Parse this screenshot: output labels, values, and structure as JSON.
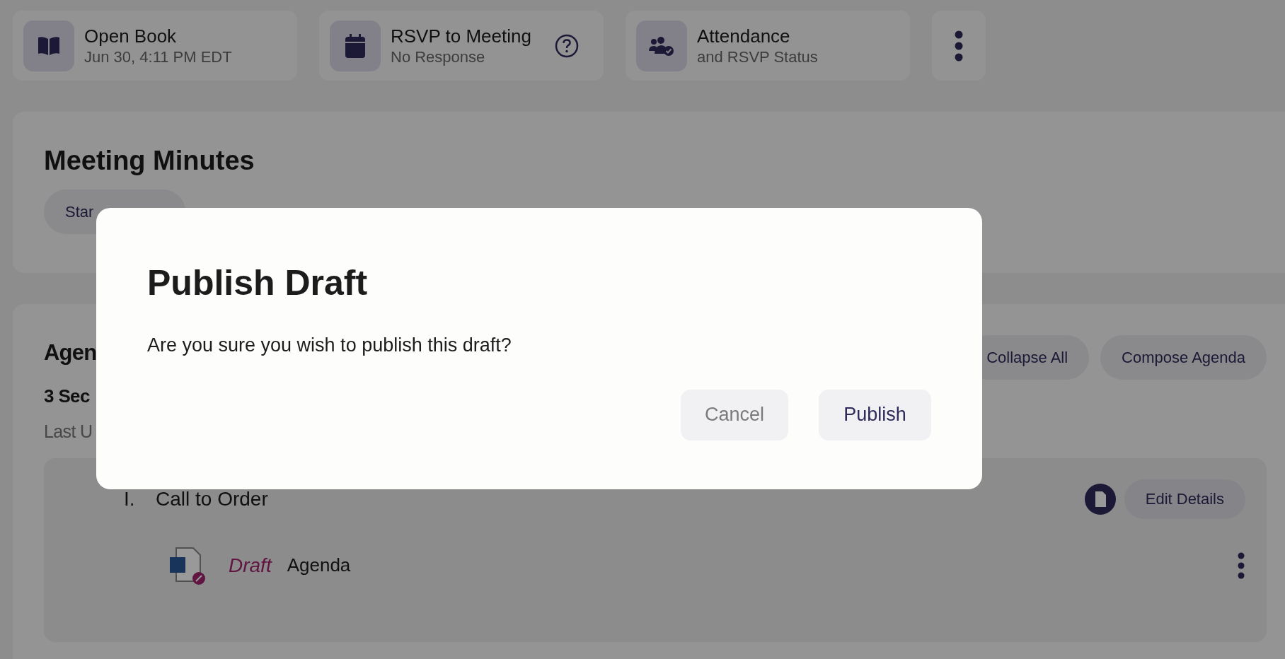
{
  "top_cards": [
    {
      "kind": "book",
      "title": "Open Book",
      "subtitle": "Jun 30, 4:11 PM EDT",
      "help": false
    },
    {
      "kind": "calendar",
      "title": "RSVP to Meeting",
      "subtitle": "No Response",
      "help": true
    },
    {
      "kind": "people",
      "title": "Attendance",
      "subtitle": "and RSVP Status",
      "help": false
    }
  ],
  "minutes": {
    "title": "Meeting Minutes",
    "button": "Star"
  },
  "agenda": {
    "title": "Agen",
    "sections": "3 Sec",
    "updated": "Last U",
    "buttons": [
      "Collapse All",
      "Compose Agenda"
    ],
    "items": [
      {
        "number": "I.",
        "title": "Call to Order",
        "action": "Edit Details",
        "documents": [
          {
            "status": "Draft",
            "name": "Agenda"
          }
        ]
      }
    ]
  },
  "dialog": {
    "title": "Publish Draft",
    "message": "Are you sure you wish to publish this draft?",
    "cancel": "Cancel",
    "confirm": "Publish"
  }
}
